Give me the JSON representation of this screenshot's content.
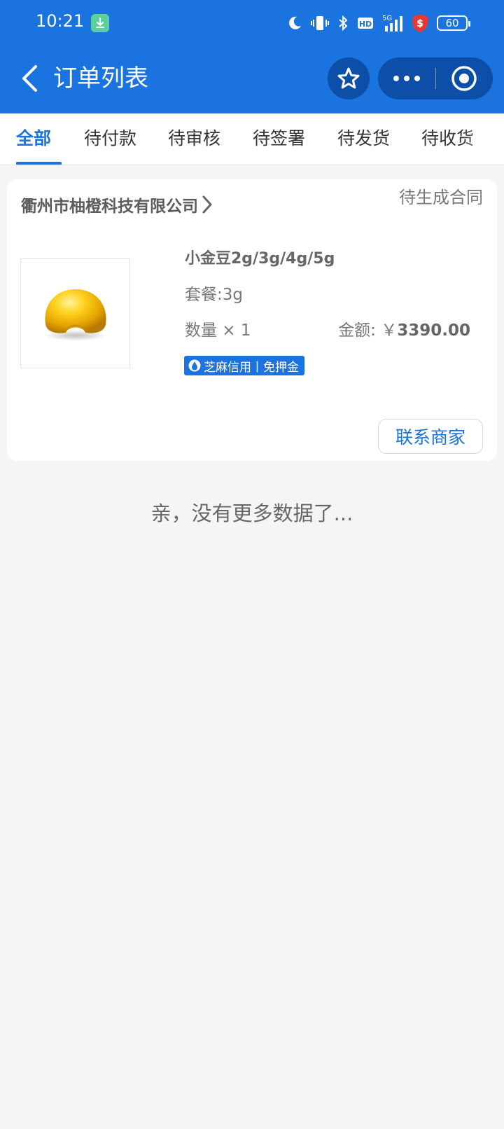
{
  "status_bar": {
    "time": "10:21",
    "battery": "60",
    "network": "5G",
    "hd": "HD"
  },
  "nav": {
    "title": "订单列表"
  },
  "tabs": [
    {
      "label": "全部",
      "active": true
    },
    {
      "label": "待付款",
      "active": false
    },
    {
      "label": "待审核",
      "active": false
    },
    {
      "label": "待签署",
      "active": false
    },
    {
      "label": "待发货",
      "active": false
    },
    {
      "label": "待收货",
      "active": false
    }
  ],
  "order": {
    "shop_name": "衢州市柚橙科技有限公司",
    "status": "待生成合同",
    "product_name": "小金豆2g/3g/4g/5g",
    "spec": "套餐:3g",
    "quantity": "数量 × 1",
    "amount_label": "金额: ￥",
    "amount_value": "3390.00",
    "badge": "芝麻信用丨免押金",
    "contact_button": "联系商家"
  },
  "footer": {
    "no_more": "亲，没有更多数据了..."
  },
  "colors": {
    "primary": "#1a73de",
    "capsule": "#0d4fa8",
    "background": "#f5f5f5"
  }
}
